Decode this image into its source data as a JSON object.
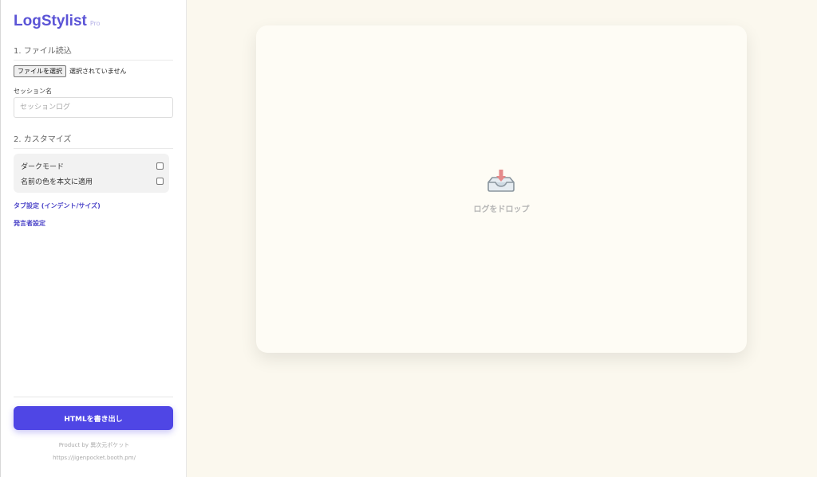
{
  "app": {
    "logo": "LogStylist",
    "logo_tag": "Pro"
  },
  "sidebar": {
    "section1_title": "1. ファイル読込",
    "file_button_label": "ファイルを選択",
    "file_status": "選択されていません",
    "session_label": "セッション名",
    "session_value": "",
    "session_placeholder": "セッションログ",
    "section2_title": "2. カスタマイズ",
    "options": [
      {
        "label": "ダークモード",
        "checked": false
      },
      {
        "label": "名前の色を本文に適用",
        "checked": false
      }
    ],
    "tab_settings_link": "タブ設定 (インデント/サイズ)",
    "speaker_settings_link": "発言者設定",
    "export_button": "HTMLを書き出し",
    "credit_line": "Product by 異次元ポケット",
    "credit_url": "https://jigenpocket.booth.pm/"
  },
  "main": {
    "drop_text": "ログをドロップ",
    "drop_icon": "inbox-tray-icon"
  },
  "colors": {
    "accent": "#4f46e5",
    "logo": "#5b54d6",
    "background": "#fbf8ee",
    "card": "#fefcf5"
  }
}
